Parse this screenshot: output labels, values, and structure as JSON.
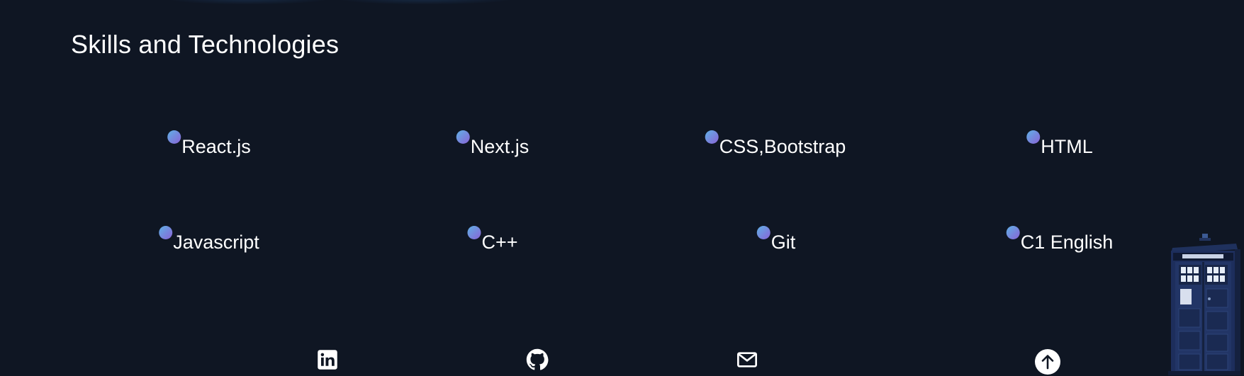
{
  "section": {
    "title": "Skills and Technologies"
  },
  "skills": [
    {
      "label": "React.js"
    },
    {
      "label": "Next.js"
    },
    {
      "label": "CSS,Bootstrap"
    },
    {
      "label": "HTML"
    },
    {
      "label": "Javascript"
    },
    {
      "label": "C++"
    },
    {
      "label": "Git"
    },
    {
      "label": "C1 English"
    }
  ],
  "footer": {
    "icons": [
      "linkedin-icon",
      "github-icon",
      "mail-icon",
      "arrow-up-icon"
    ]
  },
  "colors": {
    "background": "#0f1623",
    "text": "#ffffff",
    "dot_gradient_start": "#5fb1e6",
    "dot_gradient_end": "#8a63d6",
    "tardis_blue": "#1d2e5c"
  }
}
